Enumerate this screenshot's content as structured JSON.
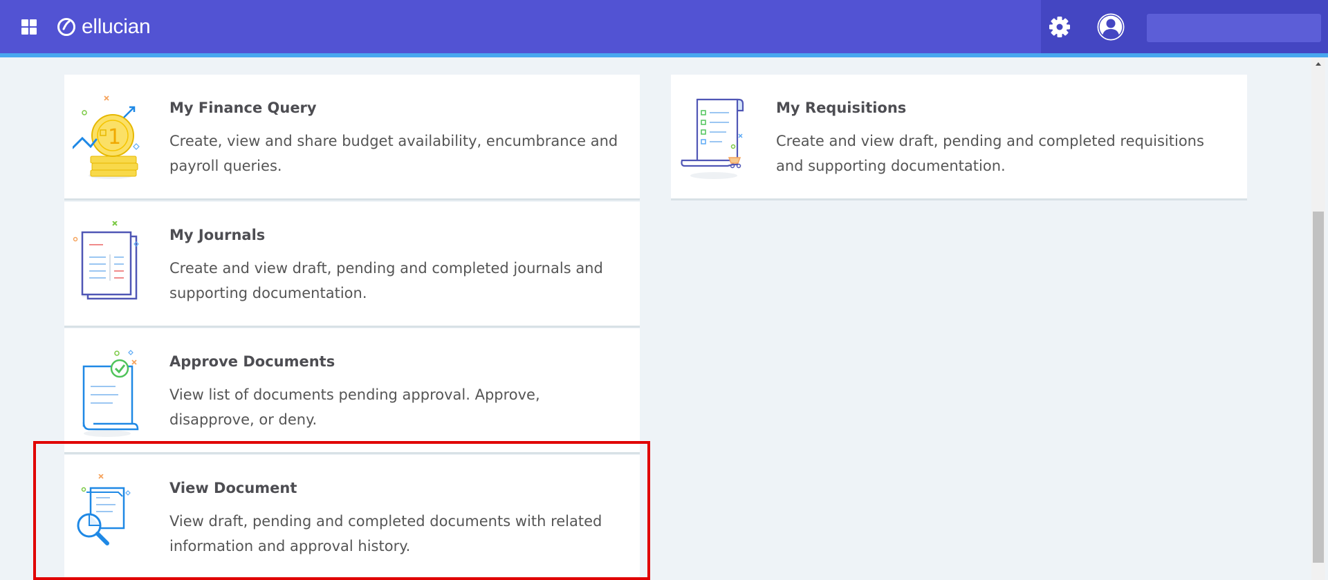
{
  "header": {
    "brand": "ellucian",
    "apps_icon": "apps-grid-icon",
    "settings_icon": "gear-icon",
    "profile_icon": "user-avatar-icon",
    "accent_color": "#5253d3",
    "stripe_color": "#48a7ef"
  },
  "cards": [
    {
      "title": "My Finance Query",
      "description": "Create, view and share budget availability, encumbrance and payroll queries.",
      "icon": "finance-coins-icon"
    },
    {
      "title": "My Journals",
      "description": "Create and view draft, pending and completed journals and supporting documentation.",
      "icon": "journal-pages-icon"
    },
    {
      "title": "Approve Documents",
      "description": "View list of documents pending approval. Approve, disapprove, or deny.",
      "icon": "approve-document-icon"
    },
    {
      "title": "View Document",
      "description": "View draft, pending and completed documents with related information and approval history.",
      "icon": "document-magnifier-icon"
    },
    {
      "title": "My Requisitions",
      "description": "Create and view draft, pending and completed requisitions and supporting documentation.",
      "icon": "requisition-scroll-icon"
    }
  ],
  "highlight_color": "#e00000"
}
